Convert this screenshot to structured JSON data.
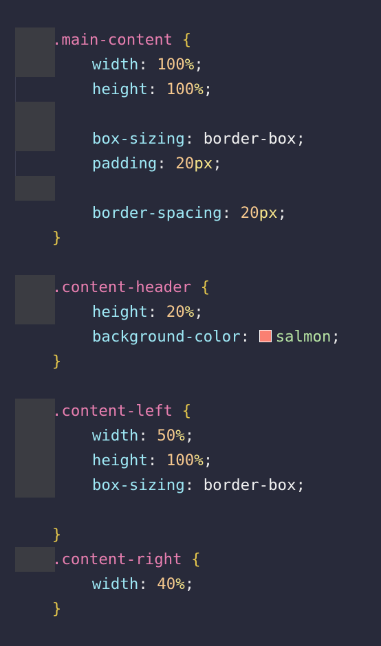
{
  "colors": {
    "background": "#282a3a",
    "selector": "#e87fb0",
    "brace": "#e6c84c",
    "property": "#9ee8f5",
    "number": "#f6c88e",
    "unit": "#f6e48a",
    "keyword": "#f2f2f2",
    "named_color": "#b6e3a3",
    "salmon_swatch": "#fa8072"
  },
  "code": {
    "main": {
      "selector": ".main-content",
      "open": "{",
      "close": "}",
      "width_prop": "width",
      "width_num": "100",
      "width_unit": "%",
      "height_prop": "height",
      "height_num": "100",
      "height_unit": "%",
      "boxsizing_prop": "box-sizing",
      "boxsizing_val": "border-box",
      "padding_prop": "padding",
      "padding_num": "20",
      "padding_unit": "px",
      "spacing_prop": "border-spacing",
      "spacing_num": "20",
      "spacing_unit": "px"
    },
    "header": {
      "selector": ".content-header",
      "open": "{",
      "close": "}",
      "height_prop": "height",
      "height_num": "20",
      "height_unit": "%",
      "bg_prop": "background-color",
      "bg_val": "salmon"
    },
    "left": {
      "selector": ".content-left",
      "open": "{",
      "close": "}",
      "width_prop": "width",
      "width_num": "50",
      "width_unit": "%",
      "height_prop": "height",
      "height_num": "100",
      "height_unit": "%",
      "boxsizing_prop": "box-sizing",
      "boxsizing_val": "border-box"
    },
    "right": {
      "selector": ".content-right",
      "open": "{",
      "close": "}",
      "width_prop": "width",
      "width_num": "40",
      "width_unit": "%"
    },
    "colon": ":",
    "semicolon": ";",
    "space": " "
  }
}
